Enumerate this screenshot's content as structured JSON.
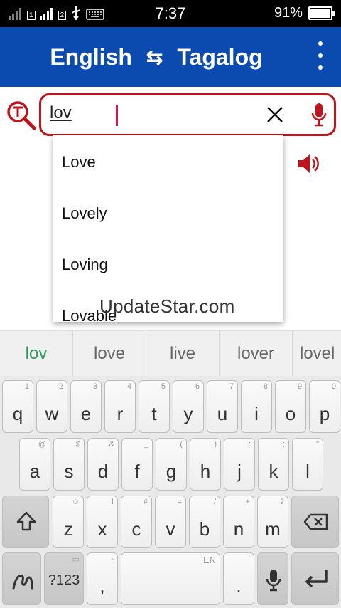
{
  "status": {
    "time": "7:37",
    "battery": "91%",
    "battery_level": 0.91,
    "sim1": "1",
    "sim2": "2"
  },
  "appbar": {
    "source_lang": "English",
    "swap_icon": "⇆",
    "target_lang": "Tagalog"
  },
  "search": {
    "value": "lov"
  },
  "autocomplete": [
    "Love",
    "Lovely",
    "Loving",
    "Lovable"
  ],
  "watermark": "UpdateStar.com",
  "suggestions": [
    "lov",
    "love",
    "live",
    "lover",
    "lovel"
  ],
  "keyboard": {
    "row1": [
      {
        "k": "q",
        "s": "1"
      },
      {
        "k": "w",
        "s": "2"
      },
      {
        "k": "e",
        "s": "3"
      },
      {
        "k": "r",
        "s": "4"
      },
      {
        "k": "t",
        "s": "5"
      },
      {
        "k": "y",
        "s": "6"
      },
      {
        "k": "u",
        "s": "7"
      },
      {
        "k": "i",
        "s": "8"
      },
      {
        "k": "o",
        "s": "9"
      },
      {
        "k": "p",
        "s": "0"
      }
    ],
    "row2": [
      {
        "k": "a",
        "s": "@"
      },
      {
        "k": "s",
        "s": "$"
      },
      {
        "k": "d",
        "s": "&"
      },
      {
        "k": "f",
        "s": "_"
      },
      {
        "k": "g",
        "s": "("
      },
      {
        "k": "h",
        "s": ")"
      },
      {
        "k": "j",
        "s": ":"
      },
      {
        "k": "k",
        "s": ";"
      },
      {
        "k": "l",
        "s": "\""
      }
    ],
    "row3": [
      {
        "k": "z",
        "s": "☺"
      },
      {
        "k": "x",
        "s": "!"
      },
      {
        "k": "c",
        "s": "#"
      },
      {
        "k": "v",
        "s": "="
      },
      {
        "k": "b",
        "s": "/"
      },
      {
        "k": "n",
        "s": "+"
      },
      {
        "k": "m",
        "s": "?"
      }
    ],
    "symbols_label": "?123",
    "comma": ",",
    "comma_sub": "-",
    "space_sub": "EN",
    "period": ".",
    "period_sub": "'"
  }
}
